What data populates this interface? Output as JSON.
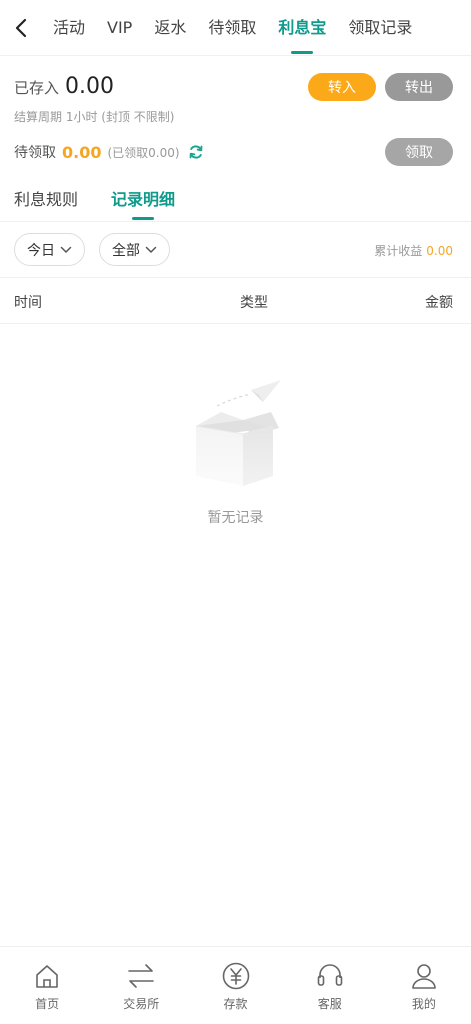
{
  "nav": {
    "tabs": [
      "活动",
      "VIP",
      "返水",
      "待领取",
      "利息宝",
      "领取记录"
    ],
    "active_tab": 4
  },
  "summary": {
    "deposited_label": "已存入",
    "deposited_value": "0.00",
    "cycle_text": "结算周期 1小时 (封顶 不限制)",
    "transfer_in": "转入",
    "transfer_out": "转出",
    "pending_label": "待领取",
    "pending_value": "0.00",
    "claimed_text": "(已领取0.00)",
    "claim_button": "领取"
  },
  "subtabs": {
    "rules": "利息规则",
    "records": "记录明细"
  },
  "filters": {
    "period": "今日",
    "category": "全部",
    "earnings_label": "累计收益",
    "earnings_value": "0.00"
  },
  "table": {
    "headers": [
      "时间",
      "类型",
      "金额"
    ]
  },
  "empty": {
    "text": "暂无记录"
  },
  "bottom_nav": {
    "items": [
      {
        "label": "首页",
        "icon": "home-icon"
      },
      {
        "label": "交易所",
        "icon": "exchange-icon"
      },
      {
        "label": "存款",
        "icon": "yuan-icon"
      },
      {
        "label": "客服",
        "icon": "headset-icon"
      },
      {
        "label": "我的",
        "icon": "user-icon"
      }
    ]
  },
  "colors": {
    "accent": "#0f9a8c",
    "amount": "#f5a623",
    "transfer_in": "#fba919",
    "gray_button": "#999999"
  }
}
